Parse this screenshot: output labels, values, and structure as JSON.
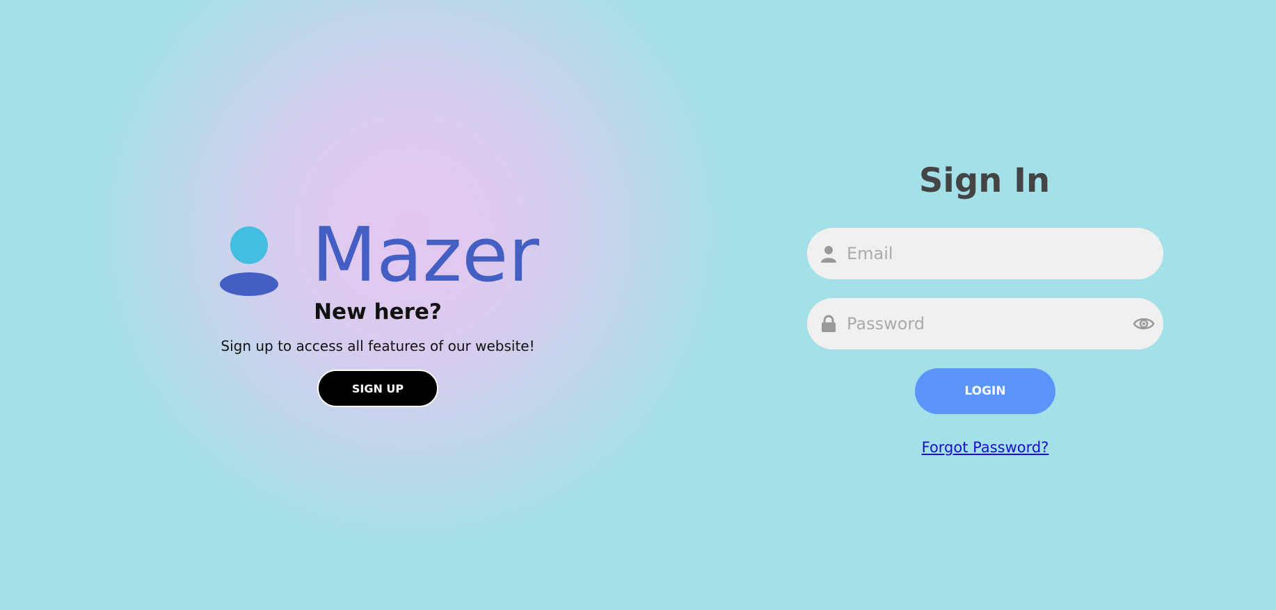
{
  "brand": {
    "name": "Mazer",
    "logo_icon": "user-logo-icon",
    "colors": {
      "head": "#43bde0",
      "body": "#445fc4"
    }
  },
  "left_panel": {
    "heading": "New here?",
    "subtext": "Sign up to access all features of our website!",
    "signup_label": "SIGN UP"
  },
  "signin": {
    "title": "Sign In",
    "email": {
      "placeholder": "Email",
      "value": "",
      "icon": "user-icon"
    },
    "password": {
      "placeholder": "Password",
      "value": "",
      "icon": "lock-icon",
      "toggle_icon": "eye-icon"
    },
    "login_label": "LOGIN",
    "forgot_label": "Forgot Password?"
  },
  "colors": {
    "background": "#a4e0e7",
    "glow": "#e3c6f0",
    "login_button": "#5b95f9",
    "signup_button": "#000000",
    "link": "#1a0dcc"
  }
}
